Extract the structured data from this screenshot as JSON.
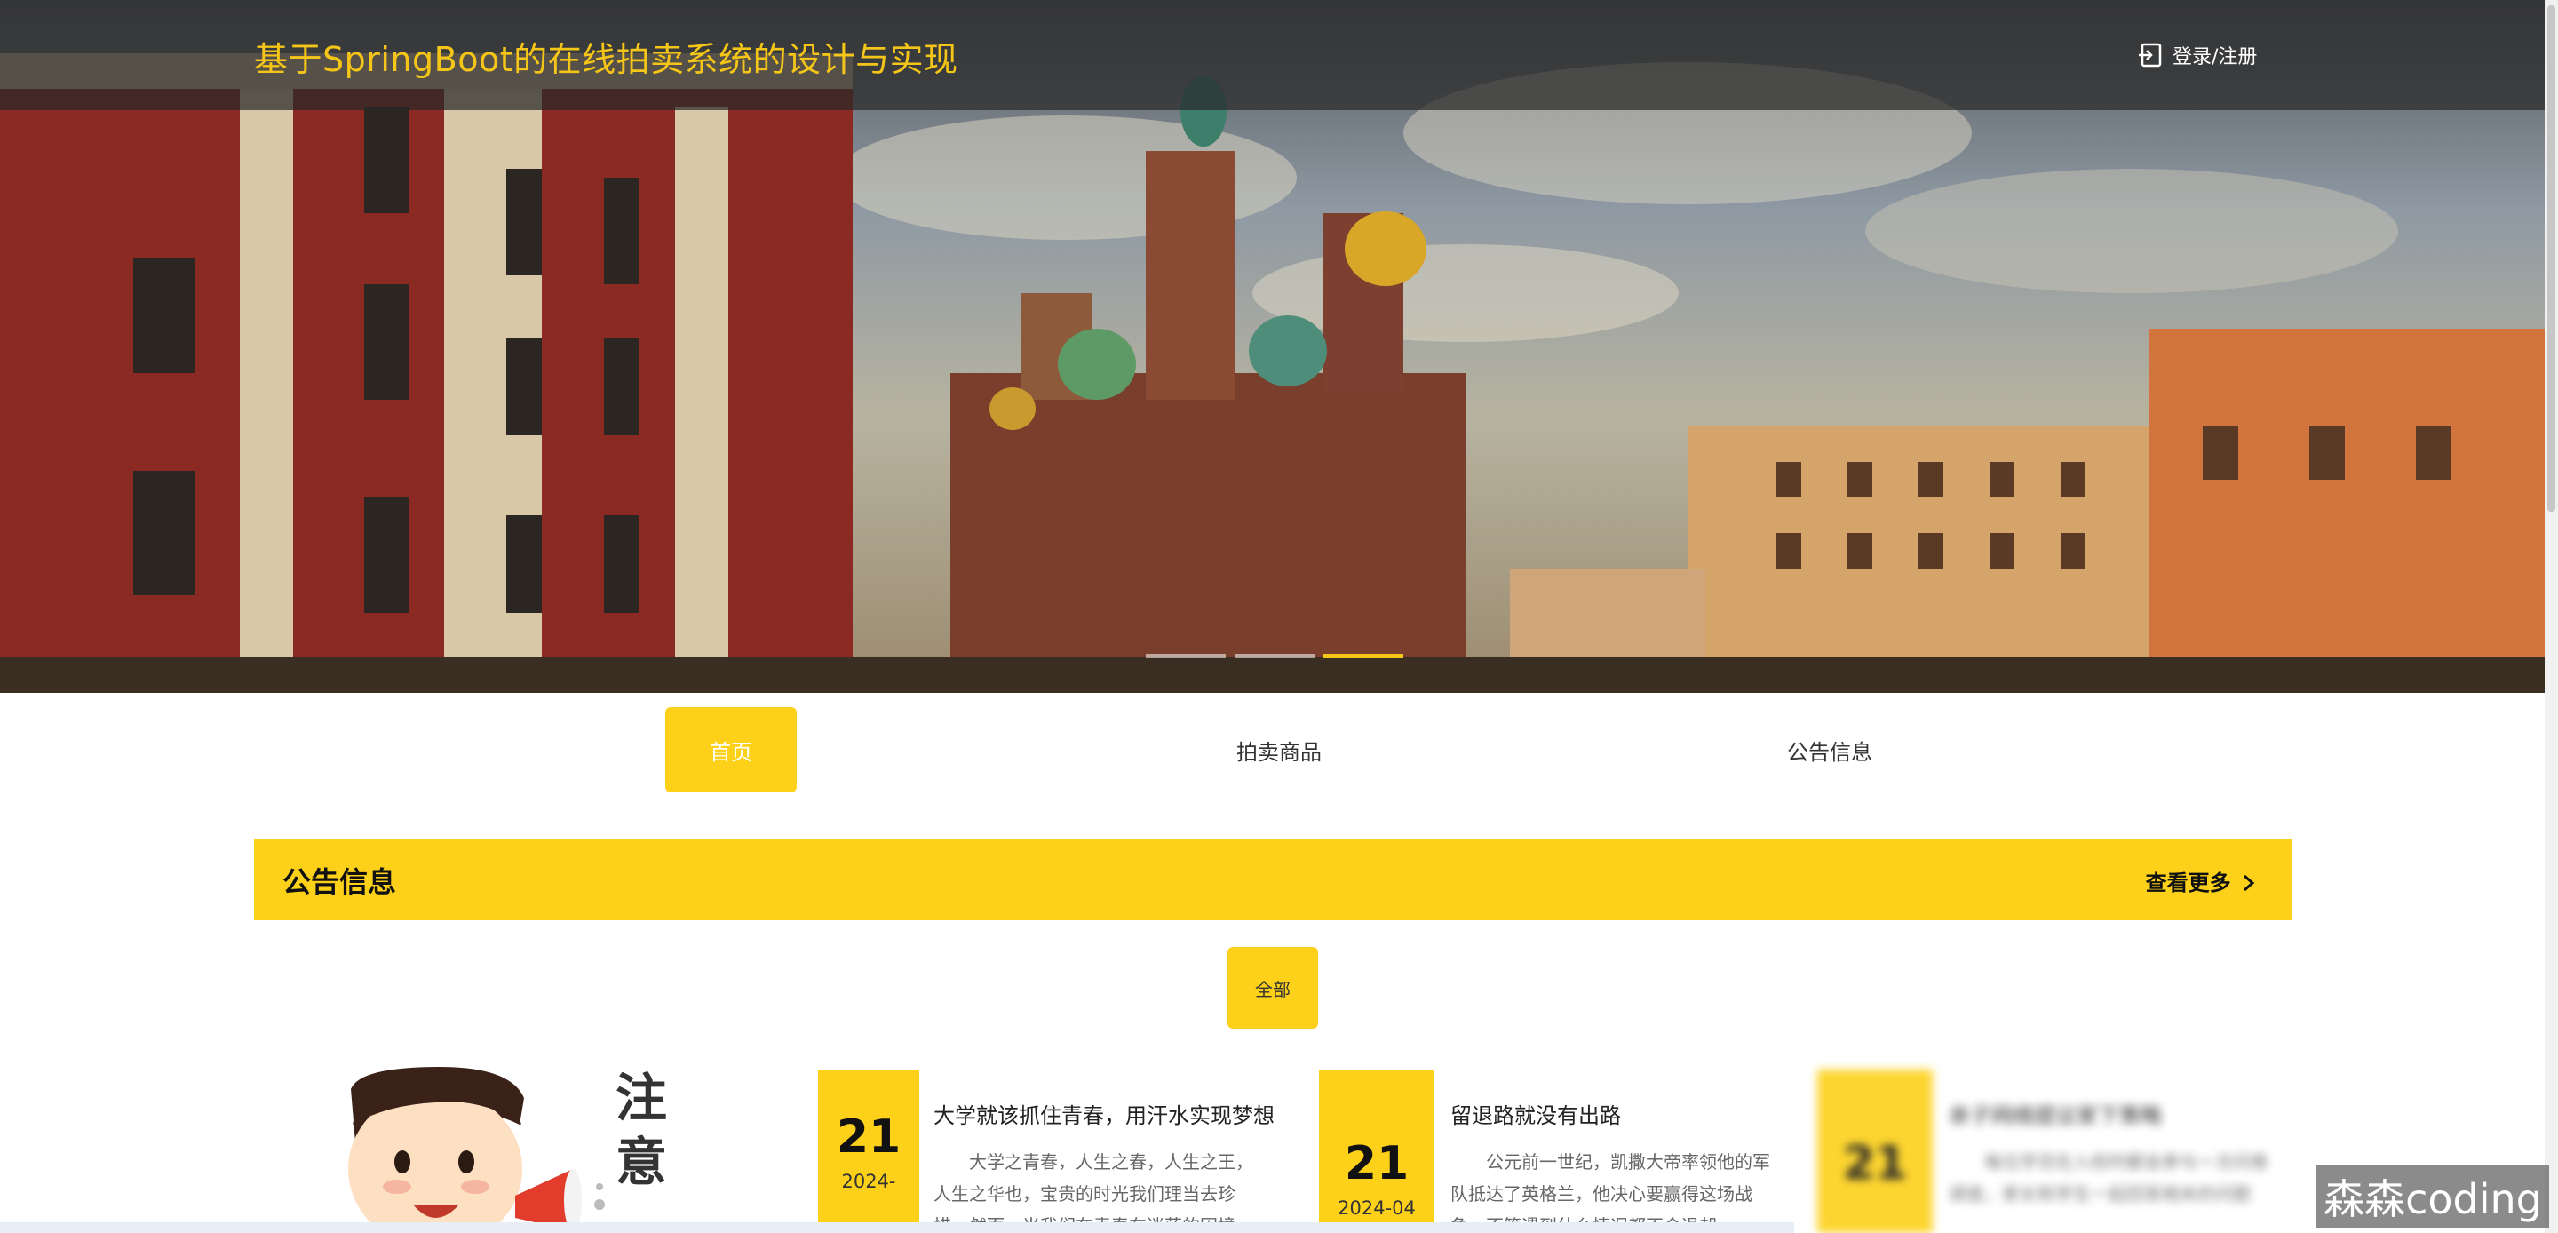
{
  "header": {
    "title": "基于SpringBoot的在线拍卖系统的设计与实现",
    "login_label": "登录/注册",
    "login_icon": "login-icon"
  },
  "carousel": {
    "slide_count": 3,
    "active_index": 2
  },
  "nav": {
    "items": [
      {
        "label": "首页",
        "active": true
      },
      {
        "label": "拍卖商品",
        "active": false
      },
      {
        "label": "公告信息",
        "active": false
      }
    ]
  },
  "notice": {
    "title": "公告信息",
    "more_label": "查看更多",
    "more_icon": "chevron-right-icon",
    "filter_label": "全部",
    "mascot_text": "注意",
    "items": [
      {
        "day": "21",
        "ym": "2024-",
        "title": "大学就该抓住青春，用汗水实现梦想",
        "body": "大学之青春，人生之春，人生之王，人生之华也，宝贵的时光我们理当去珍惜。然而，当我们在青春在迷茫的困境"
      },
      {
        "day": "21",
        "ym": "2024-04",
        "title": "留退路就没有出路",
        "body": "公元前一世纪，凯撒大帝率领他的军队抵达了英格兰，他决心要赢得这场战争，不管遇到什么情况都不会退却"
      },
      {
        "day": "21",
        "ym": "",
        "title": "亲子网络提议家下策略",
        "body": "每位学员在入校时都会参与一次问卷调查，家长和学生一起回答相关的问题"
      }
    ]
  },
  "watermark": "森森coding",
  "colors": {
    "accent": "#fdd11a",
    "title_yellow": "#f5c518"
  }
}
